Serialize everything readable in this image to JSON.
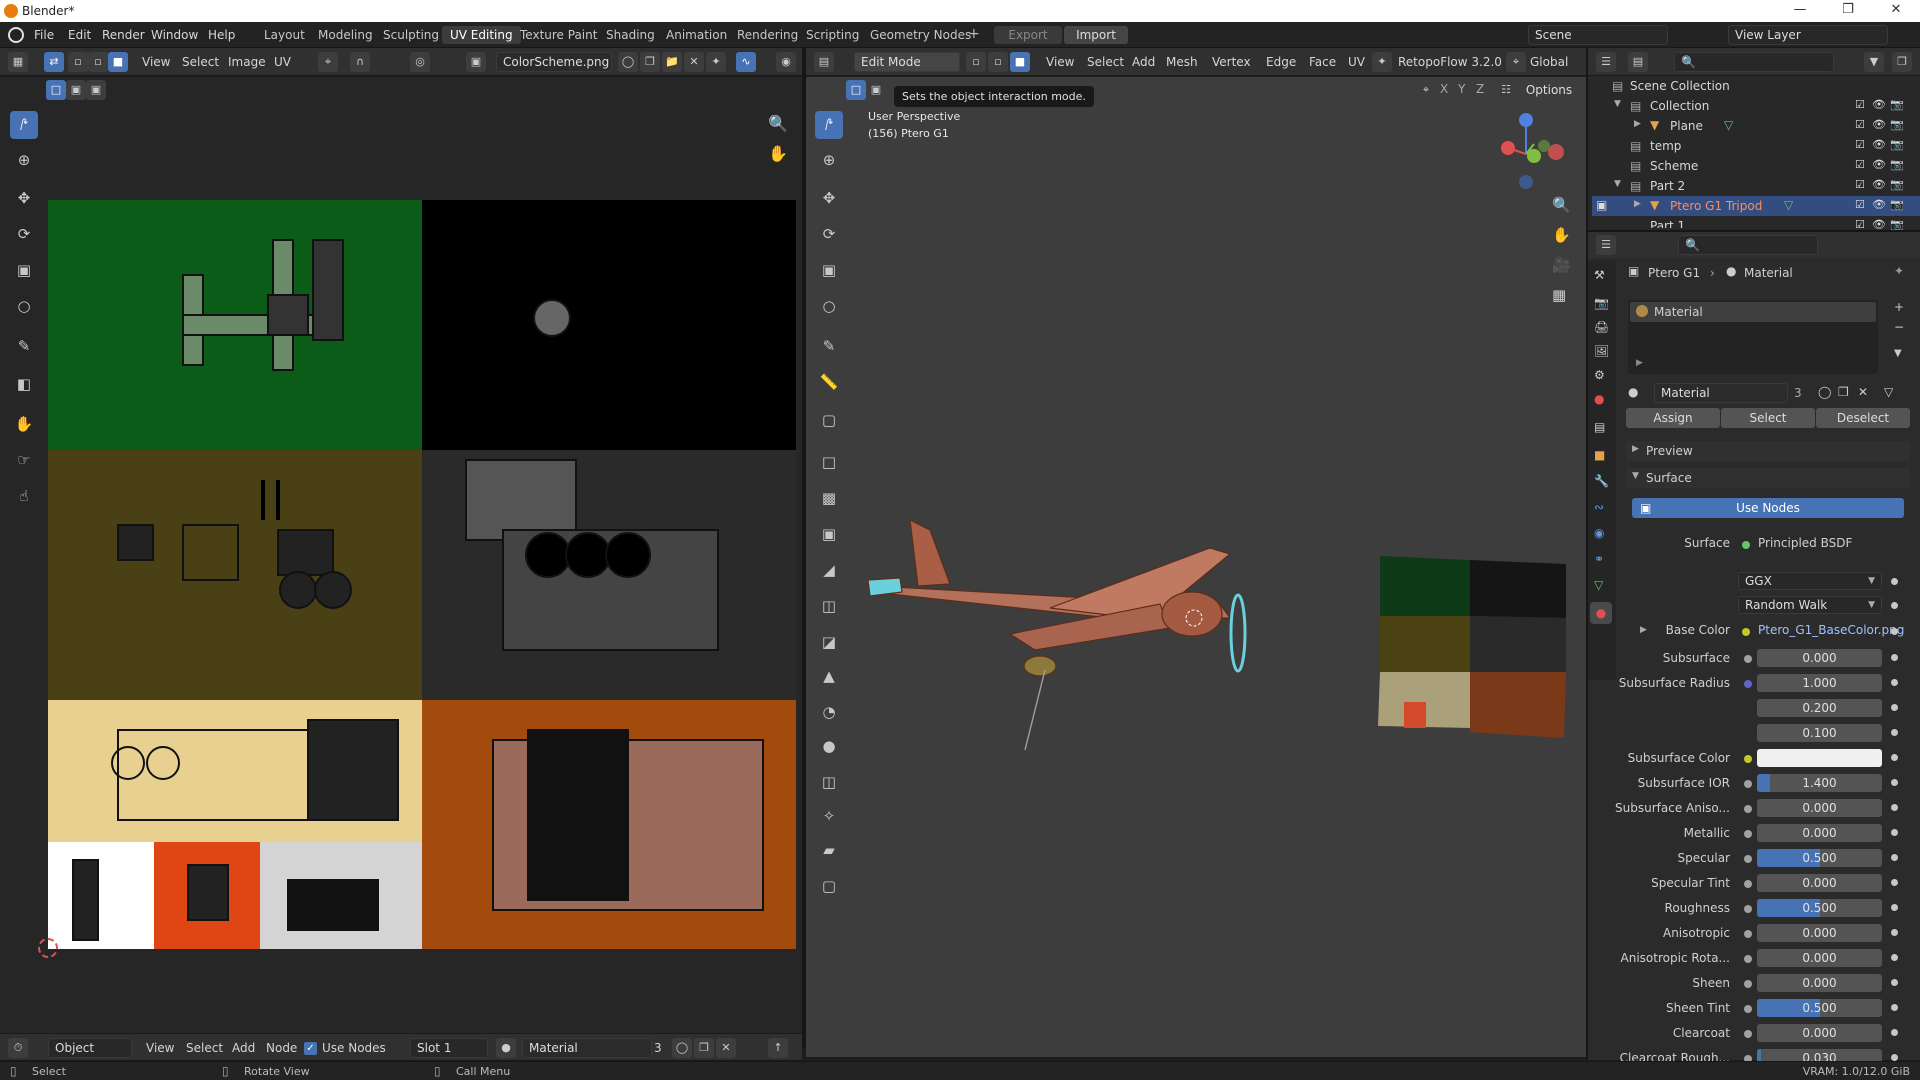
{
  "window": {
    "title": "Blender*"
  },
  "menus": [
    "File",
    "Edit",
    "Render",
    "Window",
    "Help"
  ],
  "workspaces": [
    "Layout",
    "Modeling",
    "Sculpting",
    "UV Editing",
    "Texture Paint",
    "Shading",
    "Animation",
    "Rendering",
    "Scripting",
    "Geometry Nodes"
  ],
  "active_workspace": "UV Editing",
  "top_actions": {
    "export": "Export",
    "import": "Import",
    "scene": "Scene",
    "view_layer": "View Layer"
  },
  "uv_editor": {
    "menus": [
      "View",
      "Select",
      "Image",
      "UV"
    ],
    "image_name": "ColorScheme.png"
  },
  "viewport": {
    "mode": "Edit Mode",
    "menus": [
      "View",
      "Select",
      "Add",
      "Mesh",
      "Vertex",
      "Edge",
      "Face",
      "UV"
    ],
    "addon": "RetopoFlow 3.2.0",
    "orientation": "Global",
    "options": "Options",
    "tooltip": "Sets the object interaction mode.",
    "overlay_line1": "User Perspective",
    "overlay_line2": "(156) Ptero G1",
    "axes": [
      "X",
      "Y",
      "Z"
    ]
  },
  "outliner": {
    "items": [
      {
        "label": "Scene Collection",
        "indent": 0
      },
      {
        "label": "Collection",
        "indent": 1
      },
      {
        "label": "Plane",
        "indent": 2
      },
      {
        "label": "temp",
        "indent": 1
      },
      {
        "label": "Scheme",
        "indent": 1
      },
      {
        "label": "Part 2",
        "indent": 1
      },
      {
        "label": "Ptero G1 Tripod",
        "indent": 2
      },
      {
        "label": "Part 1",
        "indent": 1
      }
    ]
  },
  "properties": {
    "breadcrumb_object": "Ptero G1",
    "breadcrumb_tab": "Material",
    "slot_name": "Material",
    "material_name": "Material",
    "user_count": "3",
    "assign": "Assign",
    "select": "Select",
    "deselect": "Deselect",
    "preview": "Preview",
    "surface_section": "Surface",
    "use_nodes": "Use Nodes",
    "surface_label": "Surface",
    "surface_value": "Principled BSDF",
    "distribution": "GGX",
    "subsurface_method": "Random Walk",
    "base_color_label": "Base Color",
    "base_color_value": "Ptero_G1_BaseColor.png",
    "fields": [
      {
        "label": "Subsurface",
        "value": "0.000",
        "fill": 0
      },
      {
        "label": "Subsurface Radius",
        "value": "1.000",
        "fill": 0
      },
      {
        "label": "",
        "value": "0.200",
        "fill": 0
      },
      {
        "label": "",
        "value": "0.100",
        "fill": 0
      },
      {
        "label": "Subsurface Color",
        "value": "",
        "fill": 0
      },
      {
        "label": "Subsurface IOR",
        "value": "1.400",
        "fill": 0.1
      },
      {
        "label": "Subsurface Aniso...",
        "value": "0.000",
        "fill": 0
      },
      {
        "label": "Metallic",
        "value": "0.000",
        "fill": 0
      },
      {
        "label": "Specular",
        "value": "0.500",
        "fill": 0.5
      },
      {
        "label": "Specular Tint",
        "value": "0.000",
        "fill": 0
      },
      {
        "label": "Roughness",
        "value": "0.500",
        "fill": 0.5
      },
      {
        "label": "Anisotropic",
        "value": "0.000",
        "fill": 0
      },
      {
        "label": "Anisotropic Rota...",
        "value": "0.000",
        "fill": 0
      },
      {
        "label": "Sheen",
        "value": "0.000",
        "fill": 0
      },
      {
        "label": "Sheen Tint",
        "value": "0.500",
        "fill": 0.5
      },
      {
        "label": "Clearcoat",
        "value": "0.000",
        "fill": 0
      },
      {
        "label": "Clearcoat Rough...",
        "value": "0.030",
        "fill": 0.03
      }
    ]
  },
  "node_header": {
    "mode": "Object",
    "menus": [
      "View",
      "Select",
      "Add",
      "Node"
    ],
    "use_nodes": "Use Nodes",
    "slot": "Slot 1",
    "material": "Material",
    "count": "3"
  },
  "statusbar": {
    "select": "Select",
    "rotate": "Rotate View",
    "call_menu": "Call Menu",
    "vram": "VRAM: 1.0/12.0 GiB"
  },
  "colors": {
    "accent": "#4772b3",
    "orange": "#e87d0d",
    "highlight_text": "#ff8b5f"
  }
}
